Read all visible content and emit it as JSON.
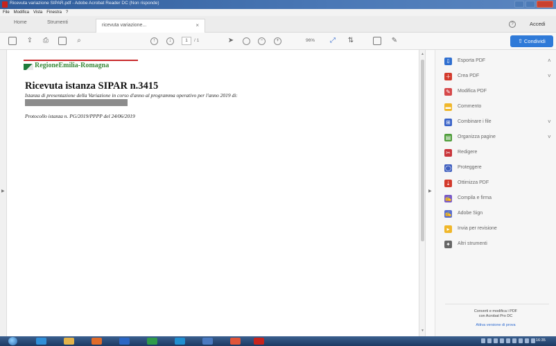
{
  "window": {
    "title": "Ricevuta variazione SIPAR.pdf - Adobe Acrobat Reader DC (Non risponde)"
  },
  "menu": [
    "File",
    "Modifica",
    "Vista",
    "Finestra",
    "?"
  ],
  "tabs": {
    "home": "Home",
    "tools": "Strumenti",
    "document": "ricevuta variazione..."
  },
  "header": {
    "signin": "Accedi"
  },
  "toolbar": {
    "page_current": "1",
    "page_total": "/ 1",
    "zoom": "96%",
    "share": "Condividi"
  },
  "document": {
    "logo_text": "RegioneEmilia-Romagna",
    "title": "Ricevuta istanza SIPAR n.3415",
    "subtitle": "Istanza di presentazione della Variazione in corso d'anno al programma operativo per l'anno 2019 di:",
    "protocol": "Protocollo istanza n. PG/2019/PPPP del 24/06/2019"
  },
  "tools_pane": {
    "items": [
      {
        "label": "Esporta PDF",
        "icon": "export-pdf-icon",
        "color": "#2f6fd0",
        "expand": true
      },
      {
        "label": "Crea PDF",
        "icon": "create-pdf-icon",
        "color": "#d33a2c",
        "expand": true
      },
      {
        "label": "Modifica PDF",
        "icon": "edit-pdf-icon",
        "color": "#d6484a",
        "expand": false
      },
      {
        "label": "Commento",
        "icon": "comment-icon",
        "color": "#f0b72a",
        "expand": false
      },
      {
        "label": "Combinare i file",
        "icon": "combine-files-icon",
        "color": "#3a63c8",
        "expand": true
      },
      {
        "label": "Organizza pagine",
        "icon": "organize-pages-icon",
        "color": "#4e9d3a",
        "expand": true
      },
      {
        "label": "Redigere",
        "icon": "redact-icon",
        "color": "#c9353b",
        "expand": false
      },
      {
        "label": "Proteggere",
        "icon": "protect-icon",
        "color": "#3f5fbf",
        "expand": false
      },
      {
        "label": "Ottimizza PDF",
        "icon": "optimize-pdf-icon",
        "color": "#d33a2c",
        "expand": false
      },
      {
        "label": "Compila e firma",
        "icon": "fill-sign-icon",
        "color": "#7a5ac8",
        "expand": false
      },
      {
        "label": "Adobe Sign",
        "icon": "adobe-sign-icon",
        "color": "#5a6fd0",
        "expand": false
      },
      {
        "label": "Invia per revisione",
        "icon": "send-review-icon",
        "color": "#f0b72a",
        "expand": false
      },
      {
        "label": "Altri strumenti",
        "icon": "more-tools-icon",
        "color": "#666666",
        "expand": false
      }
    ],
    "promo_line1": "Converti e modifica i PDF",
    "promo_line2": "con Acrobat Pro DC",
    "promo_link": "Attiva versione di prova"
  },
  "taskbar": {
    "clock": "16:35"
  }
}
